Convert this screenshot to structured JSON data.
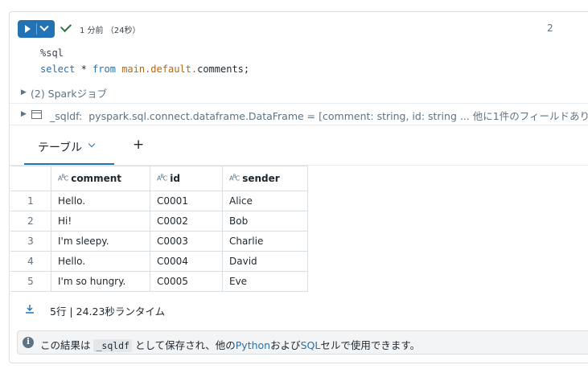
{
  "cell": {
    "run_status": "1 分前 （24秒）",
    "cell_number": "2",
    "code": {
      "magic": "%sql",
      "kw_select": "select",
      "star": " * ",
      "kw_from": "from",
      "space": " ",
      "table": "main.default.comments",
      "semi": ";"
    }
  },
  "results": {
    "spark_jobs": "(2) Sparkジョブ",
    "df_var": "_sqldf:",
    "df_desc": "pyspark.sql.connect.dataframe.DataFrame = [comment: string, id: string ... 他に1件のフィールドあり]"
  },
  "tabs": {
    "active_label": "テーブル",
    "add_symbol": "+"
  },
  "table": {
    "columns": [
      "comment",
      "id",
      "sender"
    ],
    "rows": [
      {
        "index": "1",
        "comment": "Hello.",
        "id": "C0001",
        "sender": "Alice"
      },
      {
        "index": "2",
        "comment": "Hi!",
        "id": "C0002",
        "sender": "Bob"
      },
      {
        "index": "3",
        "comment": "I'm sleepy.",
        "id": "C0003",
        "sender": "Charlie"
      },
      {
        "index": "4",
        "comment": "Hello.",
        "id": "C0004",
        "sender": "David"
      },
      {
        "index": "5",
        "comment": "I'm so hungry.",
        "id": "C0005",
        "sender": "Eve"
      }
    ]
  },
  "footer": {
    "runtime": "5行 | 24.23秒ランタイム",
    "info_prefix": "この結果は ",
    "info_var": "_sqldf",
    "info_mid": " として保存され、他の",
    "info_python": "Python",
    "info_and": "および",
    "info_sql": "SQL",
    "info_suffix": "セルで使用できます。"
  },
  "colors": {
    "accent": "#2272b4",
    "success": "#277c43",
    "table_name": "#b4690e"
  }
}
